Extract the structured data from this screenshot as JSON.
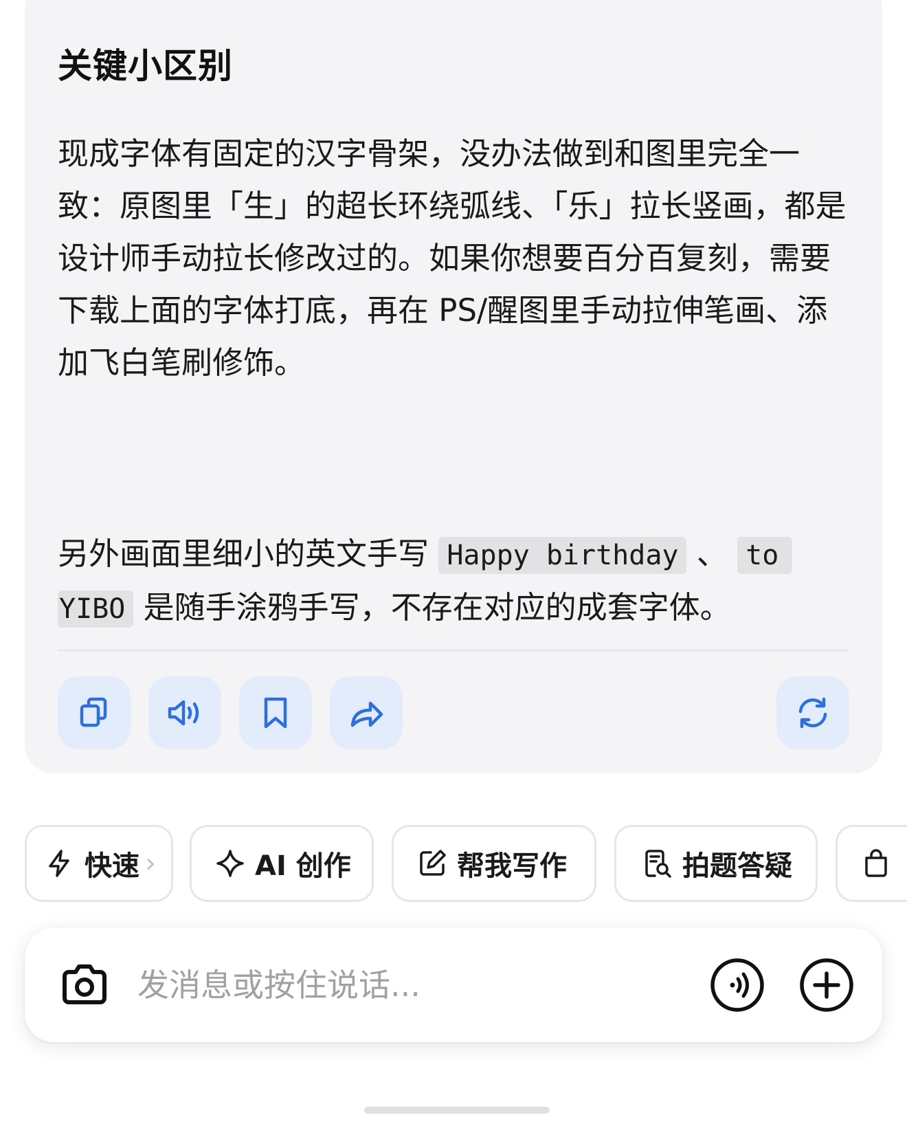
{
  "message": {
    "heading": "关键小区别",
    "paragraph1": "现成字体有固定的汉字骨架，没办法做到和图里完全一致：原图里「生」的超长环绕弧线、「乐」拉长竖画，都是设计师手动拉长修改过的。如果你想要百分百复刻，需要下载上面的字体打底，再在 PS/醒图里手动拉伸笔画、添加飞白笔刷修饰。",
    "paragraph2": {
      "prefix": "另外画面里细小的英文手写",
      "code1": "Happy birthday",
      "sep": "、",
      "code2a": "to",
      "code2b": "YIBO",
      "suffix": "是随手涂鸦手写，不存在对应的成套字体。"
    }
  },
  "actions": {
    "copy_icon": "copy-icon",
    "speak_icon": "speaker-icon",
    "bookmark_icon": "bookmark-icon",
    "share_icon": "share-icon",
    "regenerate_icon": "refresh-icon",
    "accent": "#2f6fdc",
    "bg": "#e3ecfb"
  },
  "chips": [
    {
      "icon": "lightning-icon",
      "label": "快速",
      "arrow": "›"
    },
    {
      "icon": "sparkle-icon",
      "label": "AI 创作"
    },
    {
      "icon": "edit-icon",
      "label": "帮我写作"
    },
    {
      "icon": "search-doc-icon",
      "label": "拍题答疑"
    },
    {
      "icon": "bag-icon",
      "label": ""
    }
  ],
  "input": {
    "placeholder": "发消息或按住说话..."
  }
}
